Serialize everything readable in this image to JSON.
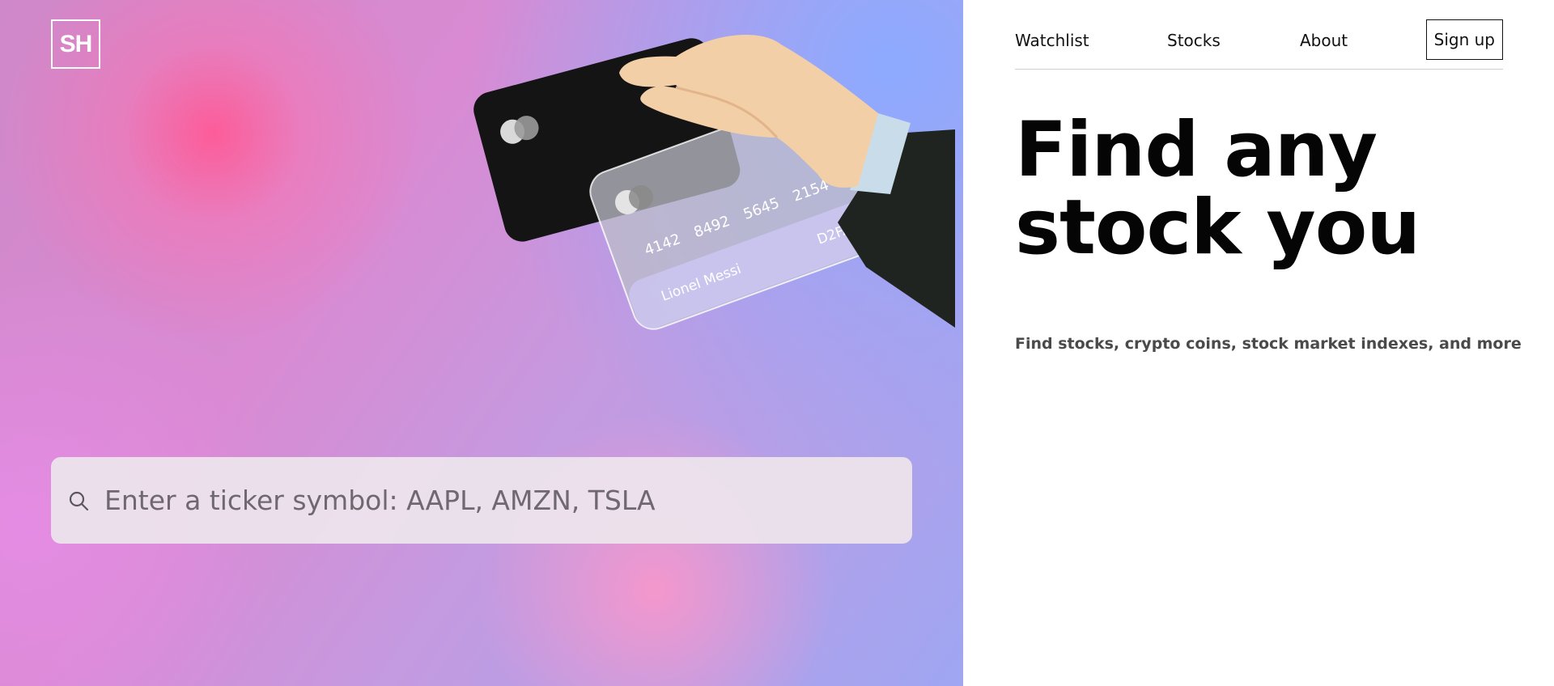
{
  "brand": {
    "logo_text": "SH"
  },
  "nav": {
    "items": [
      {
        "label": "Watchlist"
      },
      {
        "label": "Stocks"
      },
      {
        "label": "About"
      }
    ],
    "signup_label": "Sign up"
  },
  "hero": {
    "headline_line1": "Find any",
    "headline_line2": "stock you",
    "subheadline": "Find stocks, crypto coins, stock market indexes, and more"
  },
  "search": {
    "placeholder": "Enter a ticker symbol: AAPL, AMZN, TSLA",
    "icon": "search-icon"
  },
  "card": {
    "number_groups": [
      "4142",
      "8492",
      "5645",
      "2154"
    ],
    "holder": "Lionel Messi",
    "code": "D2FA"
  },
  "colors": {
    "panel_pink": "#e08ad2",
    "panel_blue": "#95a8f6",
    "text_dark": "#050505",
    "text_muted": "#4a4a4a"
  }
}
